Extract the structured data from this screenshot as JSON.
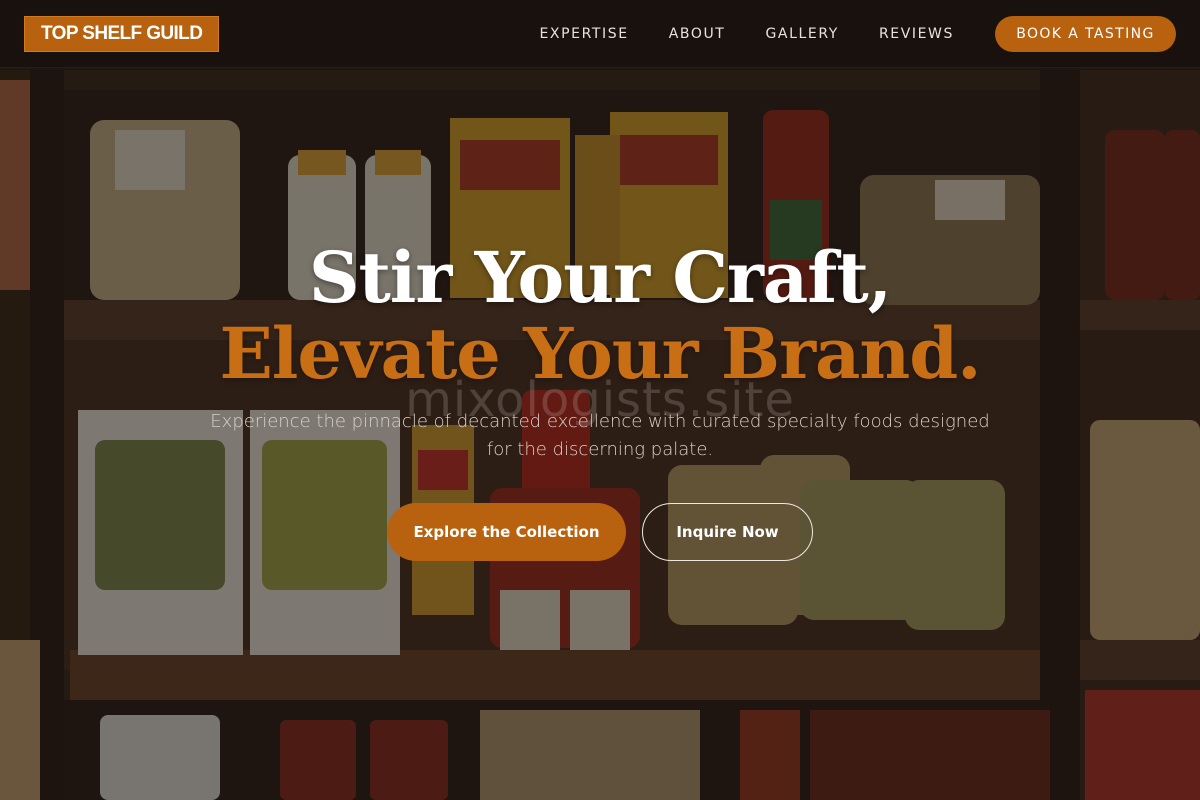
{
  "header": {
    "logo": "TOP SHELF GUILD",
    "nav": [
      {
        "label": "EXPERTISE"
      },
      {
        "label": "ABOUT"
      },
      {
        "label": "GALLERY"
      },
      {
        "label": "REVIEWS"
      }
    ],
    "cta": "BOOK A TASTING"
  },
  "hero": {
    "headline_line1": "Stir Your Craft,",
    "headline_line2": "Elevate Your Brand.",
    "watermark": "mixologists.site",
    "subtitle": "Experience the pinnacle of decanted excellence with curated specialty foods designed for the discerning palate.",
    "primary_button": "Explore the Collection",
    "secondary_button": "Inquire Now"
  },
  "colors": {
    "accent": "#b8620f",
    "headline_accent": "#c86f16",
    "header_bg": "#18110e"
  }
}
